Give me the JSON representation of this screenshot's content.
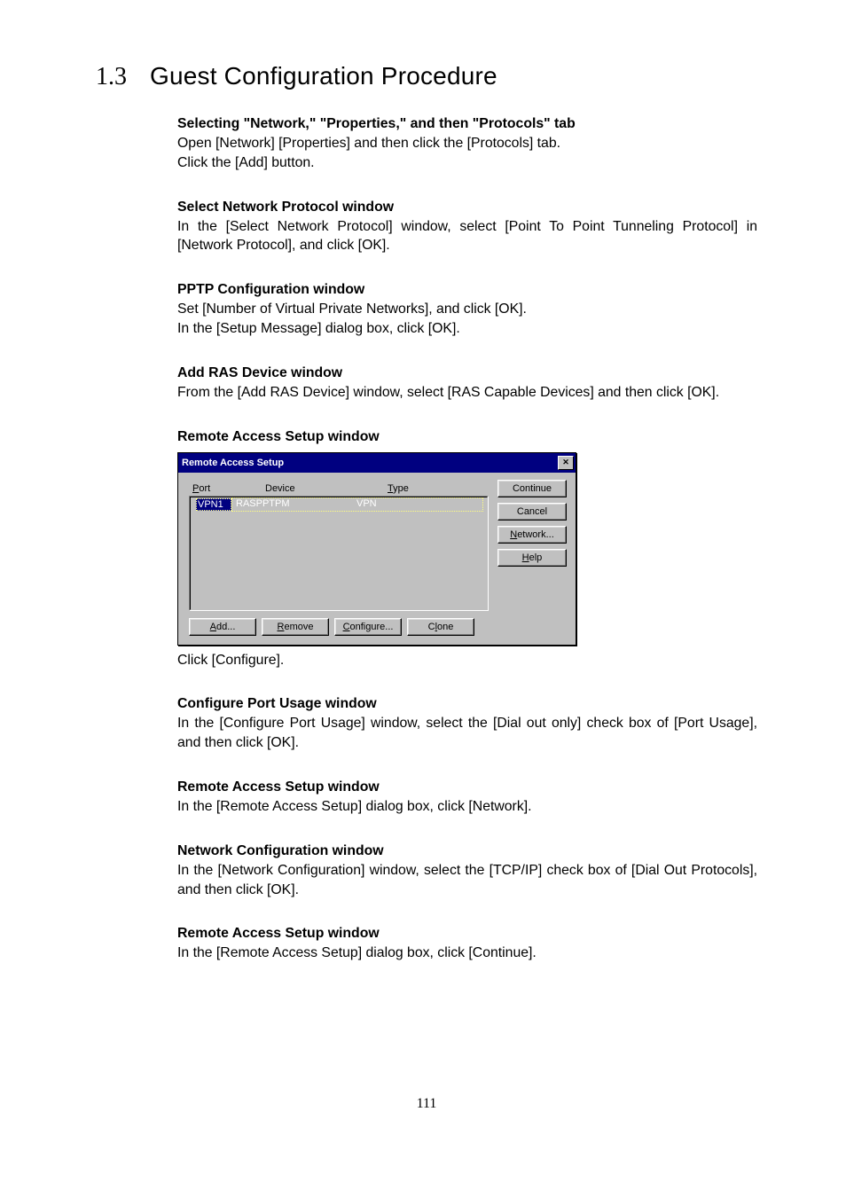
{
  "section": {
    "number": "1.3",
    "title": "Guest Configuration Procedure"
  },
  "blocks": {
    "b1": {
      "heading": "Selecting \"Network,\" \"Properties,\" and then \"Protocols\" tab",
      "line1": "Open [Network] [Properties] and then click the [Protocols] tab.",
      "line2": "Click the [Add] button."
    },
    "b2": {
      "heading": "Select Network Protocol window",
      "line1": "In the [Select Network Protocol] window, select [Point To Point Tunneling Protocol] in [Network Protocol], and click [OK]."
    },
    "b3": {
      "heading": "PPTP Configuration window",
      "line1": "Set [Number of Virtual Private Networks], and click [OK].",
      "line2": "In the [Setup Message] dialog box, click [OK]."
    },
    "b4": {
      "heading": "Add RAS Device window",
      "line1": "From the [Add RAS Device] window, select [RAS Capable Devices] and then click [OK]."
    },
    "b5": {
      "heading": "Remote Access Setup window",
      "after": "Click [Configure]."
    },
    "b6": {
      "heading": "Configure Port Usage window",
      "line1": "In the [Configure Port Usage] window, select the [Dial out only] check box of [Port Usage], and then click [OK]."
    },
    "b7": {
      "heading": "Remote Access Setup window",
      "line1": "In the [Remote Access Setup] dialog box, click [Network]."
    },
    "b8": {
      "heading": "Network Configuration window",
      "line1": "In the [Network Configuration] window, select the [TCP/IP] check box of [Dial Out Protocols], and then click [OK]."
    },
    "b9": {
      "heading": "Remote Access Setup window",
      "line1": "In the [Remote Access Setup] dialog box, click [Continue]."
    }
  },
  "dialog": {
    "title": "Remote Access Setup",
    "close": "✕",
    "columns": {
      "port": "Port",
      "device": "Device",
      "type": "Type"
    },
    "mnemonic": {
      "port": "P",
      "type": "T"
    },
    "row": {
      "port": "VPN1",
      "device": "RASPPTPM",
      "type": "VPN"
    },
    "buttons": {
      "continue": "Continue",
      "cancel": "Cancel",
      "network": "Network...",
      "help": "Help",
      "add": "Add...",
      "remove": "Remove",
      "configure": "Configure...",
      "clone": "Clone"
    },
    "mn": {
      "add": "A",
      "remove": "R",
      "configure": "C",
      "clone": "l",
      "network": "N",
      "help": "H"
    }
  },
  "page_number": "111"
}
